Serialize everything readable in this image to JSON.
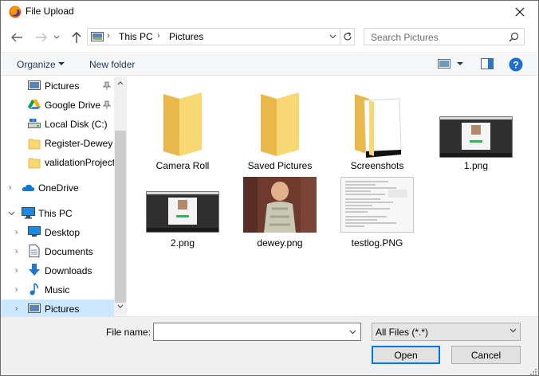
{
  "window": {
    "title": "File Upload"
  },
  "address": {
    "crumbs": [
      "This PC",
      "Pictures"
    ]
  },
  "search": {
    "placeholder": "Search Pictures"
  },
  "toolbar": {
    "organize": "Organize",
    "new_folder": "New folder"
  },
  "nav_tree": [
    {
      "label": "Pictures",
      "icon": "pictures-folder-icon",
      "pinned": true
    },
    {
      "label": "Google Drive",
      "icon": "google-drive-icon",
      "pinned": true
    },
    {
      "label": "Local Disk (C:)",
      "icon": "local-disk-icon",
      "pinned": false
    },
    {
      "label": "Register-Dewey",
      "icon": "folder-icon",
      "pinned": false
    },
    {
      "label": "validationProject",
      "icon": "folder-icon",
      "pinned": false
    },
    {
      "label": "OneDrive",
      "icon": "onedrive-icon",
      "pinned": false
    },
    {
      "label": "This PC",
      "icon": "this-pc-icon",
      "pinned": false
    },
    {
      "label": "Desktop",
      "icon": "desktop-icon",
      "pinned": false
    },
    {
      "label": "Documents",
      "icon": "documents-icon",
      "pinned": false
    },
    {
      "label": "Downloads",
      "icon": "downloads-icon",
      "pinned": false
    },
    {
      "label": "Music",
      "icon": "music-icon",
      "pinned": false
    },
    {
      "label": "Pictures",
      "icon": "pictures-folder-icon",
      "pinned": false,
      "selected": true
    }
  ],
  "files": [
    {
      "name": "Camera Roll",
      "kind": "folder"
    },
    {
      "name": "Saved Pictures",
      "kind": "folder"
    },
    {
      "name": "Screenshots",
      "kind": "folder-with-content"
    },
    {
      "name": "1.png",
      "kind": "screenshot-thumb"
    },
    {
      "name": "2.png",
      "kind": "screenshot-thumb"
    },
    {
      "name": "dewey.png",
      "kind": "photo-thumb"
    },
    {
      "name": "testlog.PNG",
      "kind": "log-thumb"
    }
  ],
  "bottom": {
    "file_name_label": "File name:",
    "file_name_value": "",
    "file_type": "All Files (*.*)",
    "open_label": "Open",
    "cancel_label": "Cancel"
  },
  "colors": {
    "accent": "#0078d7",
    "selected_bg": "#cce8ff",
    "folder": "#f8d775"
  }
}
